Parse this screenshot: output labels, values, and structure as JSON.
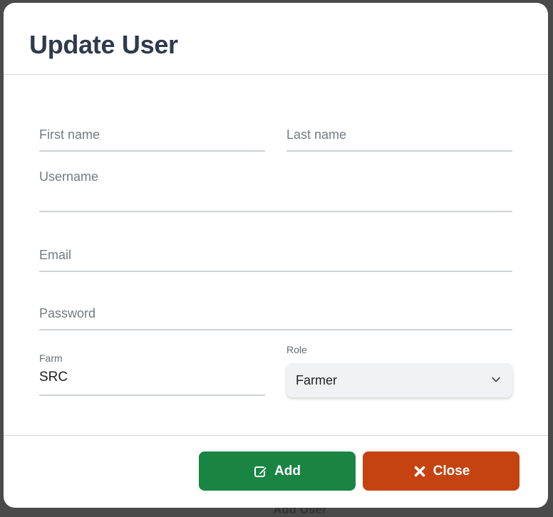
{
  "modal": {
    "title": "Update User"
  },
  "form": {
    "first_name": {
      "placeholder": "First name",
      "value": ""
    },
    "last_name": {
      "placeholder": "Last name",
      "value": ""
    },
    "username": {
      "placeholder": "Username",
      "value": ""
    },
    "email": {
      "placeholder": "Email",
      "value": ""
    },
    "password": {
      "placeholder": "Password",
      "value": ""
    },
    "farm": {
      "label": "Farm",
      "value": "SRC"
    },
    "role": {
      "label": "Role",
      "selected": "Farmer"
    }
  },
  "buttons": {
    "add_label": "Add",
    "close_label": "Close"
  },
  "backdrop": {
    "bottom_button": "Add User"
  },
  "colors": {
    "add": "#1a8443",
    "close": "#c54310",
    "title": "#2f3a4d"
  }
}
